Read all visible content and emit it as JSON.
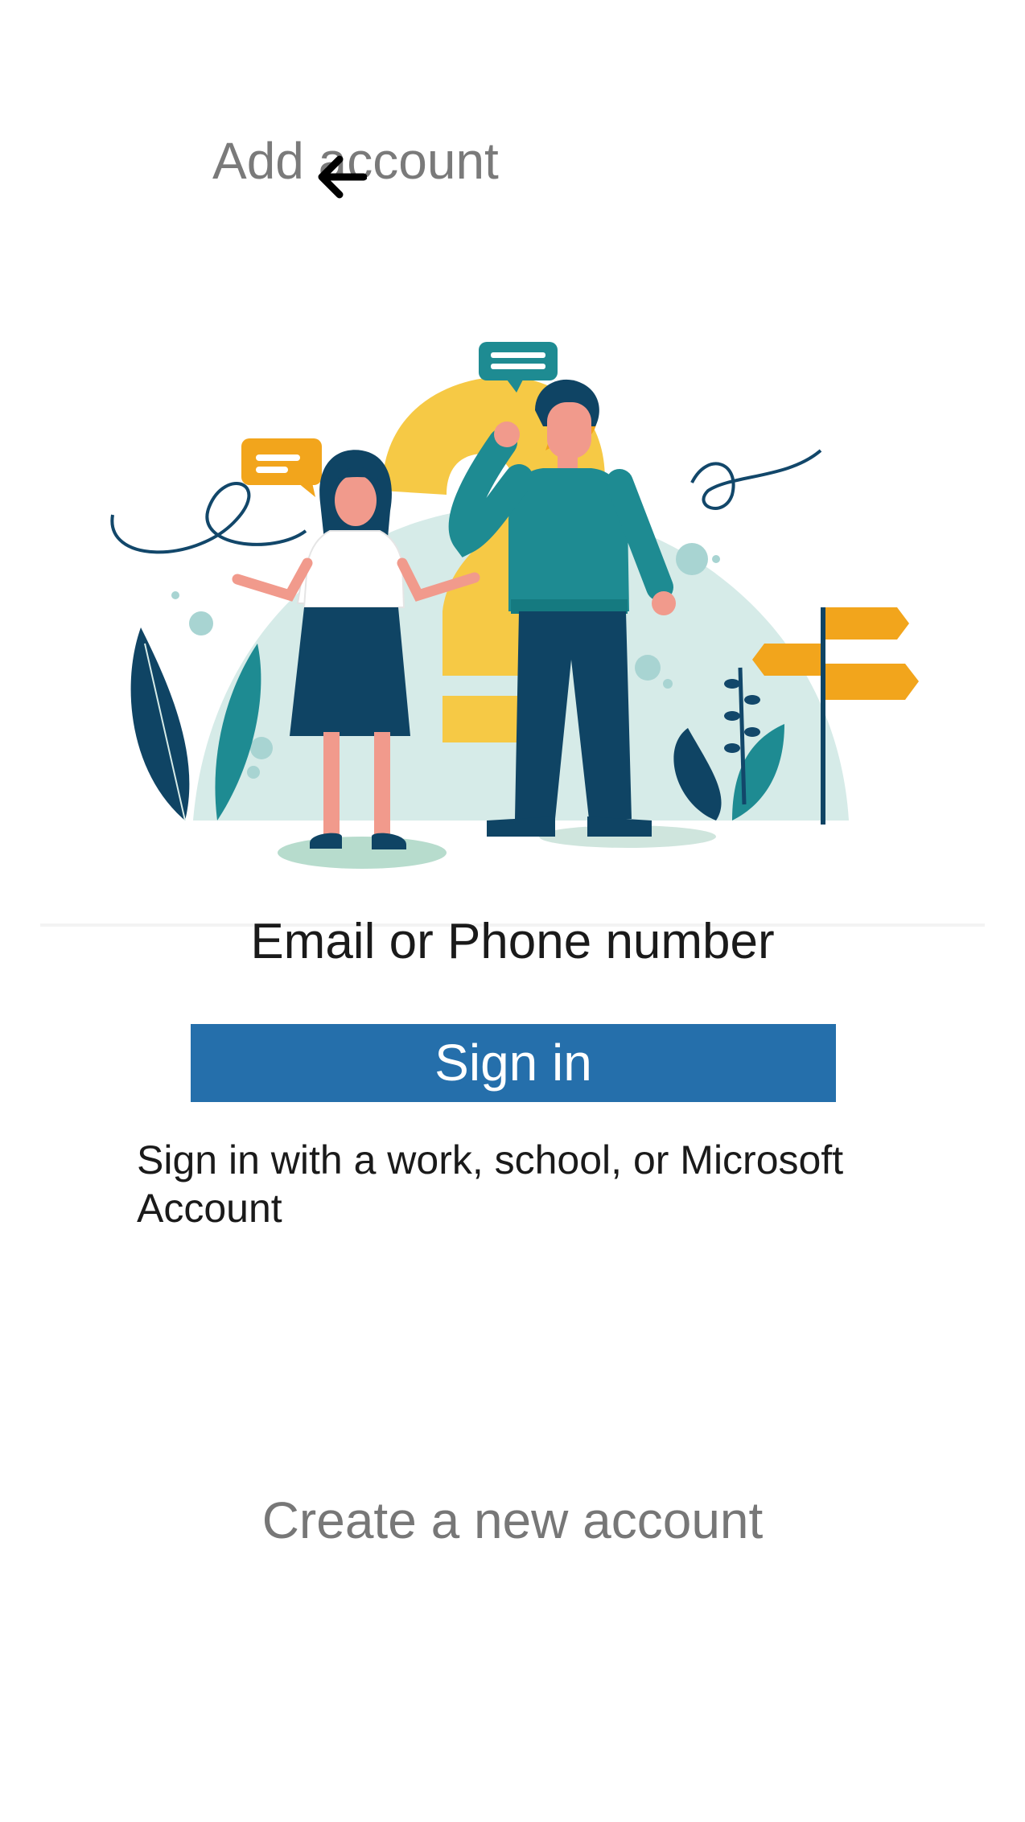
{
  "header": {
    "title": "Add account",
    "back_icon": "back-arrow-icon"
  },
  "illustration": {
    "icon": "confused-people-question-mark-illustration",
    "colors": {
      "yellow": "#f6c945",
      "teal": "#1e8b92",
      "navy": "#0f4464",
      "orange": "#f2a51c",
      "mint": "#d6ebe8",
      "skin": "#f19a8c"
    }
  },
  "form": {
    "email_placeholder": "Email or Phone number",
    "signin_label": "Sign in",
    "signin_color": "#256fab",
    "description": "Sign in with a work, school, or Microsoft Account"
  },
  "footer": {
    "create_account_label": "Create a new account"
  }
}
